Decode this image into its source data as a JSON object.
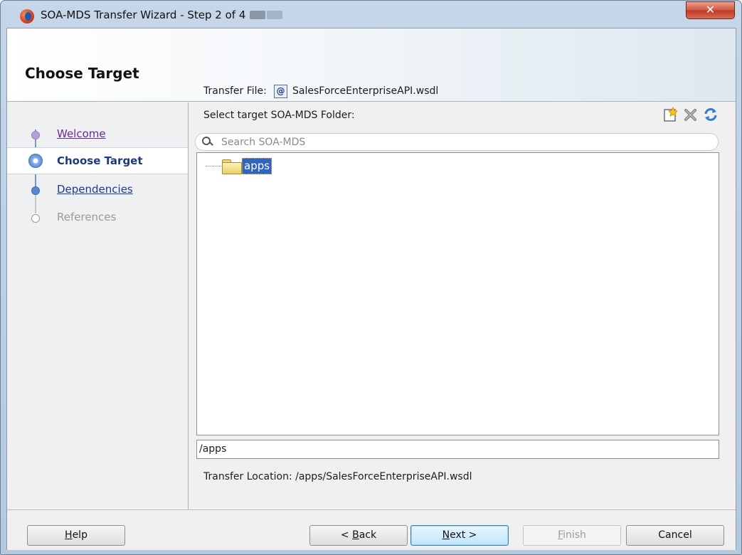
{
  "window": {
    "title": "SOA-MDS Transfer Wizard - Step 2 of 4",
    "close_glyph": "✕"
  },
  "header": {
    "title": "Choose Target"
  },
  "steps": [
    {
      "label": "Welcome",
      "state": "visited"
    },
    {
      "label": "Choose Target",
      "state": "current"
    },
    {
      "label": "Dependencies",
      "state": "link"
    },
    {
      "label": "References",
      "state": "disabled"
    }
  ],
  "content": {
    "transfer_file_label": "Transfer File:",
    "transfer_file_icon_text": "@",
    "transfer_file_name": "SalesForceEnterpriseAPI.wsdl",
    "select_folder_label": "Select target SOA-MDS Folder:",
    "toolbar_icons": [
      "new-folder-icon",
      "delete-icon",
      "refresh-icon"
    ],
    "search_placeholder": "Search SOA-MDS",
    "tree": [
      {
        "label": "apps",
        "selected": true,
        "icon": "folder-icon"
      }
    ],
    "path_value": "/apps",
    "transfer_location": "Transfer Location: /apps/SalesForceEnterpriseAPI.wsdl"
  },
  "buttons": {
    "help": {
      "pre": "",
      "mnemonic": "H",
      "post": "elp"
    },
    "back": {
      "pre": "< ",
      "mnemonic": "B",
      "post": "ack"
    },
    "next": {
      "pre": "",
      "mnemonic": "N",
      "post": "ext >"
    },
    "finish": {
      "pre": "",
      "mnemonic": "F",
      "post": "inish"
    },
    "cancel": {
      "pre": "Cancel",
      "mnemonic": "",
      "post": ""
    }
  },
  "colors": {
    "accent": "#2f64c3",
    "visited_link": "#6c2a8e",
    "link": "#1a3c8f",
    "close_button": "#c13a24"
  }
}
